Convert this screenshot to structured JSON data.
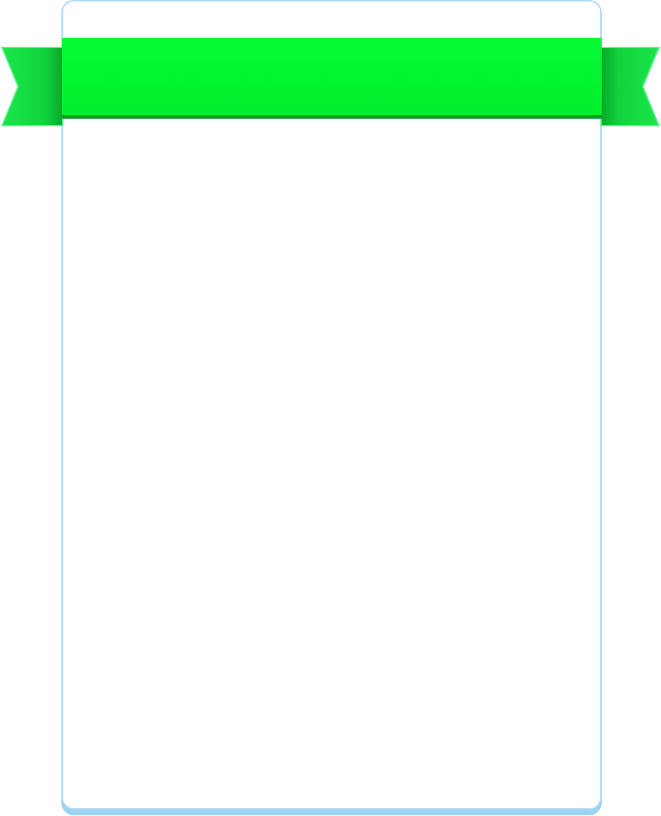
{
  "banner": {
    "title": "",
    "color": "#00f72e",
    "edge_color": "#0a9a1c",
    "tail_color": "#15e84a"
  },
  "card": {
    "border_color": "#a7d9f2",
    "shadow_color": "#9dd3f2",
    "background": "#ffffff"
  }
}
